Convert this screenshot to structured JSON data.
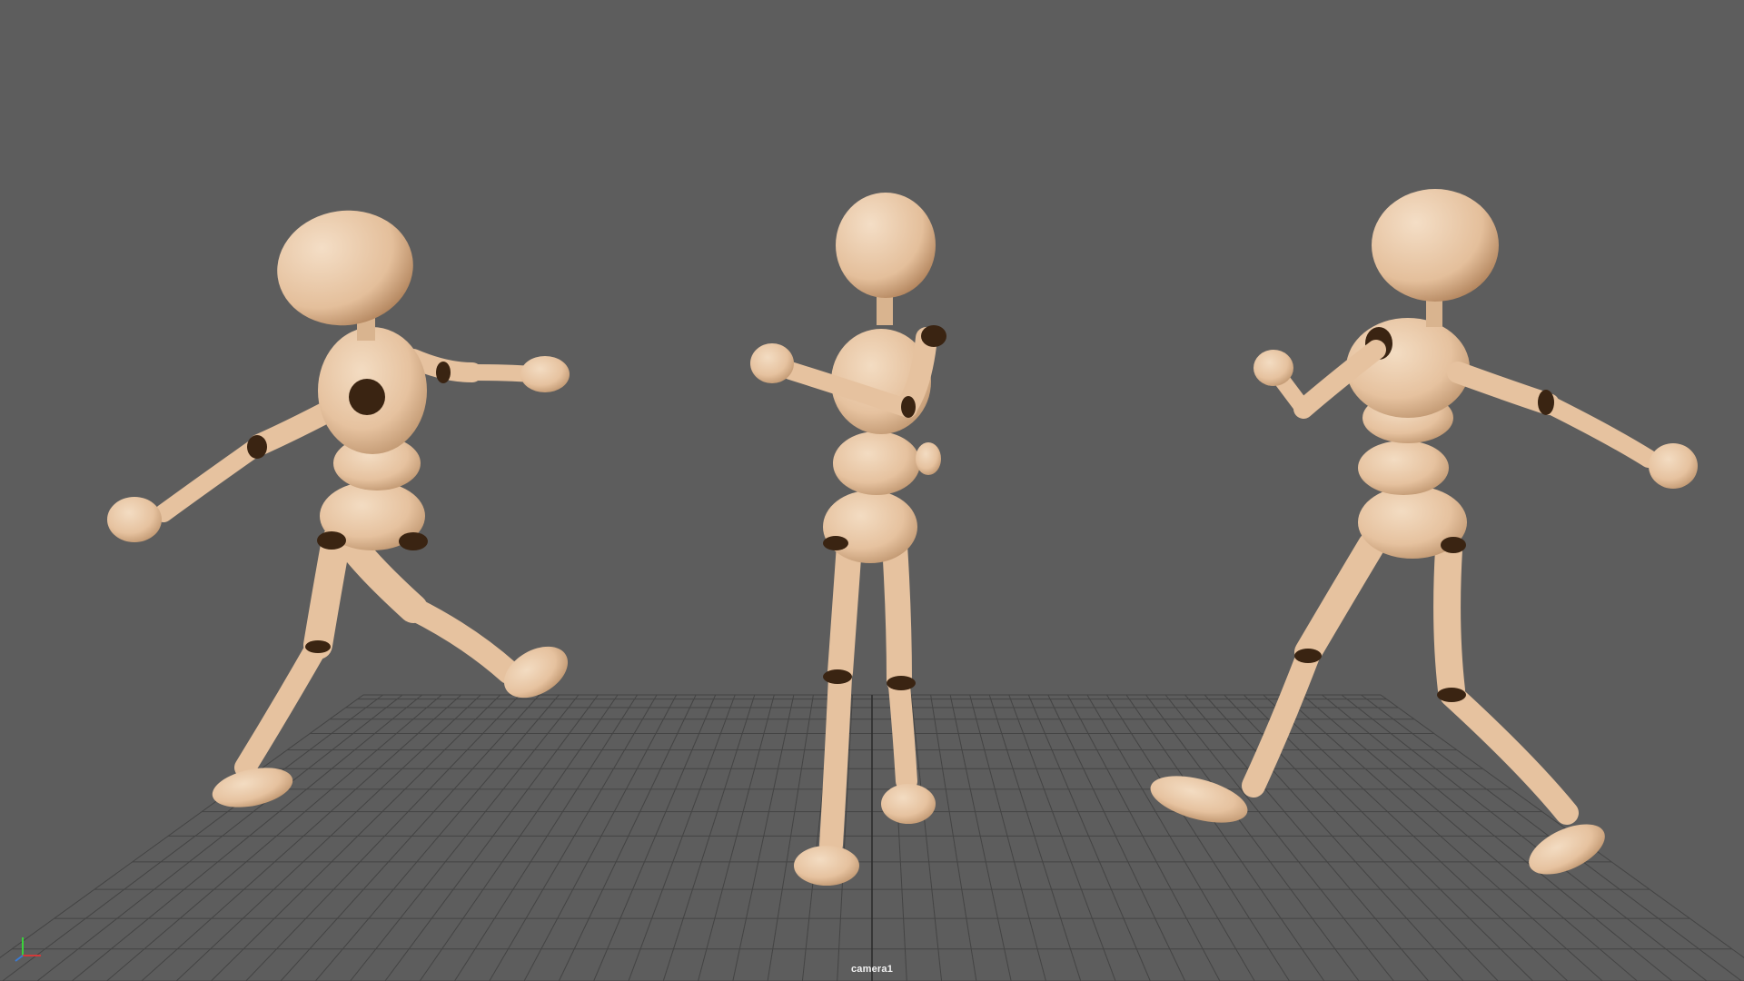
{
  "viewport": {
    "camera_name": "camera1",
    "background_color": "#5d5d5d",
    "grid_color": "#444444",
    "grid_axis_color": "#2a2a2a"
  },
  "scene": {
    "figures": [
      {
        "name": "mannequin-left",
        "skin_color": "#e9c7a6"
      },
      {
        "name": "mannequin-center",
        "skin_color": "#e9c7a6"
      },
      {
        "name": "mannequin-right",
        "skin_color": "#e9c7a6"
      }
    ],
    "joint_color": "#3a2412"
  },
  "axis_gizmo": {
    "x_color": "#d23a3a",
    "y_color": "#3ad23a",
    "z_color": "#3a7ad2"
  }
}
